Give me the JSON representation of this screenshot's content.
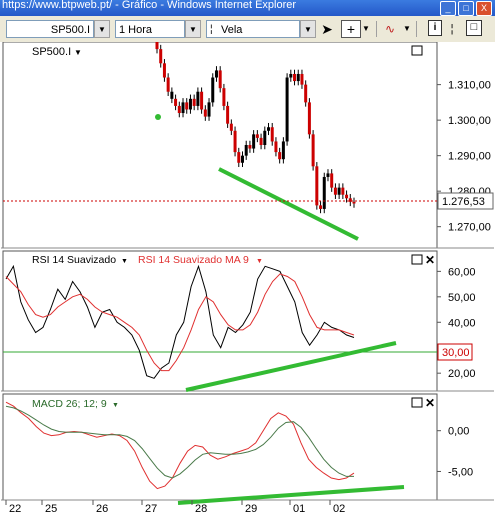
{
  "window": {
    "title": "https://www.btpweb.pt/ - Gráfico - Windows Internet Explorer",
    "minimize": "_",
    "maximize": "□",
    "close": "X"
  },
  "toolbar": {
    "symbol": "SP500.I",
    "interval": "1 Hora",
    "chart_type": "Vela",
    "crosshair": "+",
    "info": "i",
    "box": "□"
  },
  "panels": {
    "price": {
      "label": "SP500.I",
      "axis_ticks": [
        "1.310,00",
        "1.300,00",
        "1.290,00",
        "1.280,00",
        "1.270,00"
      ],
      "current_value": "1.276,53"
    },
    "rsi": {
      "label1": "RSI 14 Suavizado",
      "label2": "RSI 14 Suavizado MA 9",
      "axis_ticks": [
        "60,00",
        "50,00",
        "40,00",
        "20,00"
      ],
      "level": "30,00"
    },
    "macd": {
      "label": "MACD 26; 12; 9",
      "axis_ticks": [
        "0,00",
        "-5,00"
      ]
    }
  },
  "xaxis": [
    "22",
    "25",
    "26",
    "27",
    "28",
    "29",
    "01",
    "02"
  ],
  "colors": {
    "candle_up": "#000000",
    "candle_down": "#cc0000",
    "rsi_line": "#000000",
    "rsi_ma": "#e03030",
    "macd_signal": "#4a7a4a",
    "macd_line": "#e03030",
    "trendline": "#33bb33",
    "current_price": "#cc0000"
  },
  "chart_data": [
    {
      "type": "candlestick",
      "title": "SP500.I",
      "ylim": [
        1264,
        1322
      ],
      "close": [
        1320,
        1316,
        1312,
        1308,
        1306,
        1304,
        1302,
        1305,
        1303,
        1306,
        1304,
        1308,
        1303,
        1301,
        1305,
        1312,
        1314,
        1309,
        1304,
        1299,
        1297,
        1291,
        1288,
        1290,
        1293,
        1292,
        1296,
        1295,
        1293,
        1297,
        1298,
        1294,
        1291,
        1289,
        1294,
        1312,
        1313,
        1311,
        1313,
        1310,
        1305,
        1296,
        1287,
        1276,
        1275,
        1284,
        1285,
        1281,
        1279,
        1281,
        1279,
        1278,
        1277,
        1276.53
      ],
      "up_down": [
        "d",
        "d",
        "d",
        "d",
        "u",
        "d",
        "d",
        "u",
        "d",
        "u",
        "d",
        "u",
        "d",
        "d",
        "u",
        "u",
        "u",
        "d",
        "d",
        "d",
        "d",
        "d",
        "d",
        "u",
        "u",
        "d",
        "u",
        "d",
        "d",
        "u",
        "u",
        "d",
        "d",
        "d",
        "u",
        "u",
        "u",
        "d",
        "u",
        "d",
        "d",
        "d",
        "d",
        "d",
        "d",
        "u",
        "u",
        "d",
        "d",
        "u",
        "d",
        "d",
        "d",
        "d"
      ]
    },
    {
      "type": "line",
      "title": "RSI 14 Suavizado",
      "ylim": [
        13,
        68
      ],
      "series": [
        {
          "name": "RSI 14 Suavizado",
          "values": [
            57,
            62,
            48,
            41,
            36,
            38,
            45,
            53,
            49,
            56,
            52,
            46,
            38,
            44,
            45,
            40,
            38,
            35,
            29,
            19,
            18,
            22,
            24,
            35,
            40,
            54,
            62,
            52,
            35,
            30,
            38,
            36,
            39,
            44,
            57,
            62,
            61,
            60,
            54,
            48,
            36,
            31,
            35,
            40,
            38,
            37,
            35,
            34
          ]
        },
        {
          "name": "RSI 14 Suavizado MA 9",
          "values": [
            58,
            55,
            52,
            47,
            43,
            42,
            43,
            46,
            48,
            50,
            51,
            49,
            46,
            44,
            43,
            42,
            40,
            38,
            35,
            29,
            24,
            21,
            21,
            25,
            30,
            37,
            45,
            50,
            48,
            43,
            39,
            37,
            37,
            39,
            44,
            51,
            56,
            59,
            58,
            56,
            50,
            43,
            38,
            37,
            37,
            37,
            36,
            35
          ]
        }
      ]
    },
    {
      "type": "line",
      "title": "MACD 26; 12; 9",
      "ylim": [
        -8.5,
        4.5
      ],
      "series": [
        {
          "name": "MACD",
          "values": [
            3.5,
            3.0,
            2.2,
            1.5,
            0.5,
            -0.3,
            -0.6,
            -0.5,
            -0.2,
            -0.1,
            -0.2,
            -0.5,
            -0.8,
            -0.6,
            -0.4,
            -0.6,
            -1.2,
            -2.5,
            -4.5,
            -6.2,
            -7.1,
            -6.8,
            -5.8,
            -4.0,
            -2.5,
            -1.8,
            -2.0,
            -3.0,
            -3.5,
            -3.2,
            -2.8,
            -2.5,
            -2.2,
            -1.5,
            0.0,
            1.5,
            2.2,
            1.8,
            0.8,
            -1.5,
            -3.5,
            -4.5,
            -5.2,
            -5.8,
            -6.0,
            -5.8,
            -5.2
          ]
        },
        {
          "name": "Signal",
          "values": [
            3.0,
            2.8,
            2.4,
            1.9,
            1.3,
            0.7,
            0.2,
            -0.1,
            -0.2,
            -0.2,
            -0.2,
            -0.3,
            -0.4,
            -0.5,
            -0.5,
            -0.5,
            -0.7,
            -1.2,
            -2.2,
            -3.4,
            -4.6,
            -5.5,
            -5.8,
            -5.3,
            -4.5,
            -3.6,
            -2.9,
            -2.7,
            -2.8,
            -2.9,
            -2.9,
            -2.8,
            -2.6,
            -2.3,
            -1.7,
            -0.8,
            0.3,
            1.0,
            1.1,
            0.4,
            -0.8,
            -2.2,
            -3.5,
            -4.5,
            -5.2,
            -5.6,
            -5.6
          ]
        }
      ]
    }
  ]
}
